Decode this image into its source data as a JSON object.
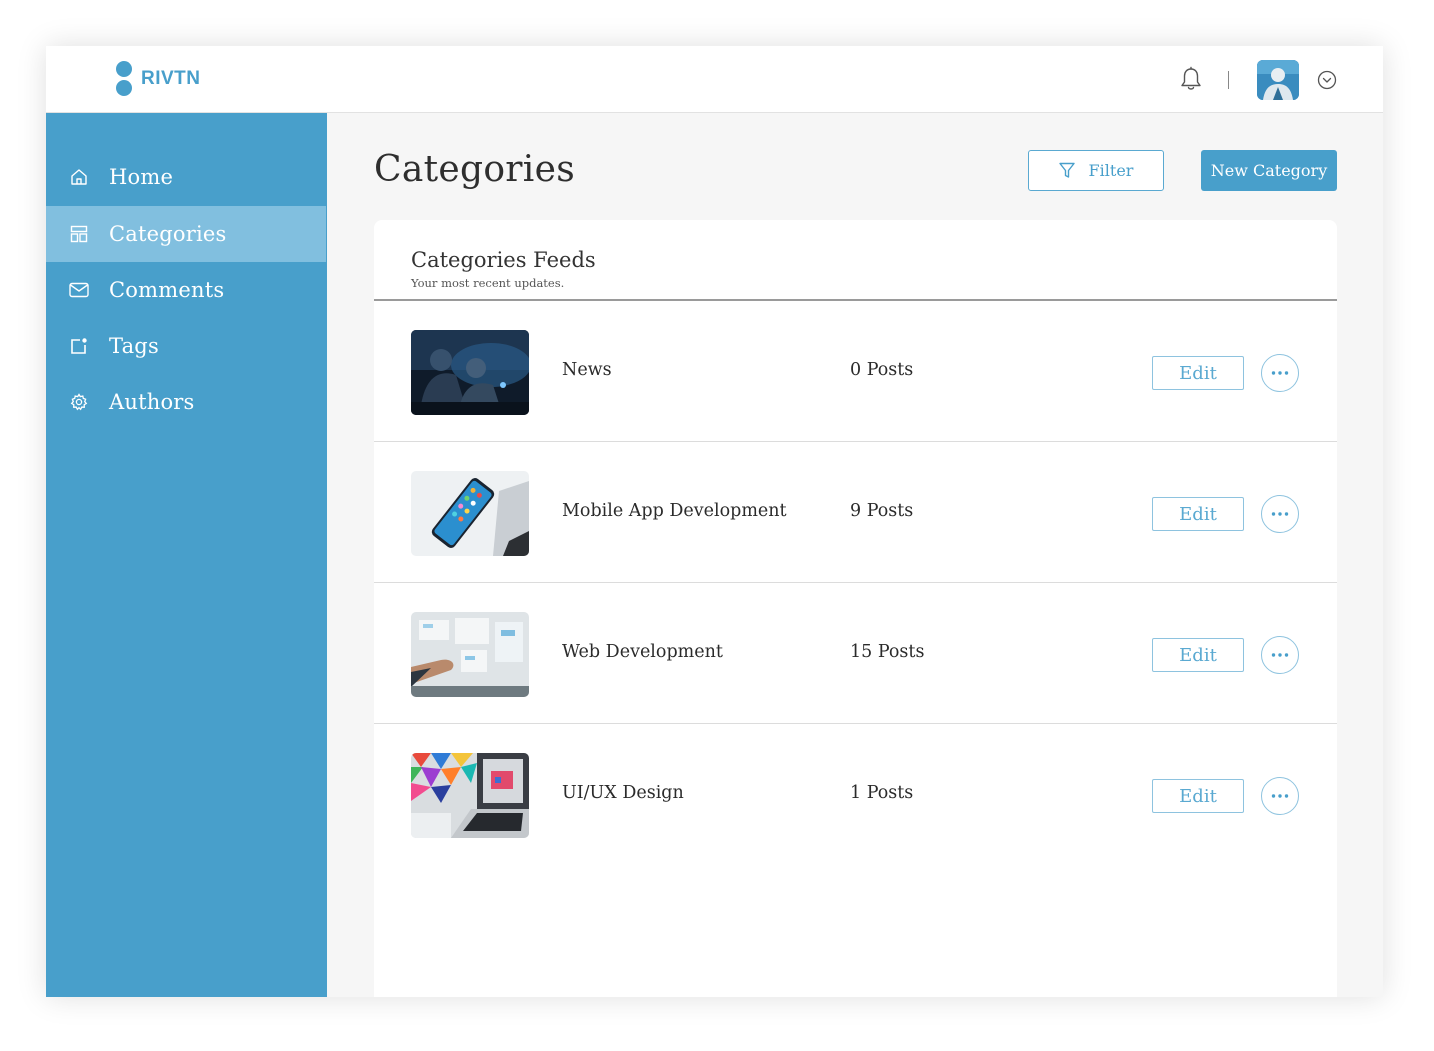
{
  "app": {
    "brand": "RIVTN",
    "accent_color": "#489fcb"
  },
  "header": {
    "icons": [
      "bell-icon",
      "avatar",
      "chevron-down-circle-icon"
    ]
  },
  "sidebar": {
    "items": [
      {
        "label": "Home",
        "icon": "home-icon",
        "active": false
      },
      {
        "label": "Categories",
        "icon": "layout-icon",
        "active": true
      },
      {
        "label": "Comments",
        "icon": "mail-icon",
        "active": false
      },
      {
        "label": "Tags",
        "icon": "tag-icon",
        "active": false
      },
      {
        "label": "Authors",
        "icon": "gear-icon",
        "active": false
      }
    ]
  },
  "main": {
    "title": "Categories",
    "filter_label": "Filter",
    "new_label": "New Category",
    "feed": {
      "title": "Categories Feeds",
      "subtitle": "Your most recent updates.",
      "rows": [
        {
          "name": "News",
          "count": "0 Posts",
          "edit_label": "Edit",
          "thumb": "soldiers-photo"
        },
        {
          "name": "Mobile App Development",
          "count": "9 Posts",
          "edit_label": "Edit",
          "thumb": "smartphone-photo"
        },
        {
          "name": "Web Development",
          "count": "15 Posts",
          "edit_label": "Edit",
          "thumb": "whiteboard-photo"
        },
        {
          "name": "UI/UX Design",
          "count": "1 Posts",
          "edit_label": "Edit",
          "thumb": "laptop-photo"
        }
      ]
    }
  }
}
